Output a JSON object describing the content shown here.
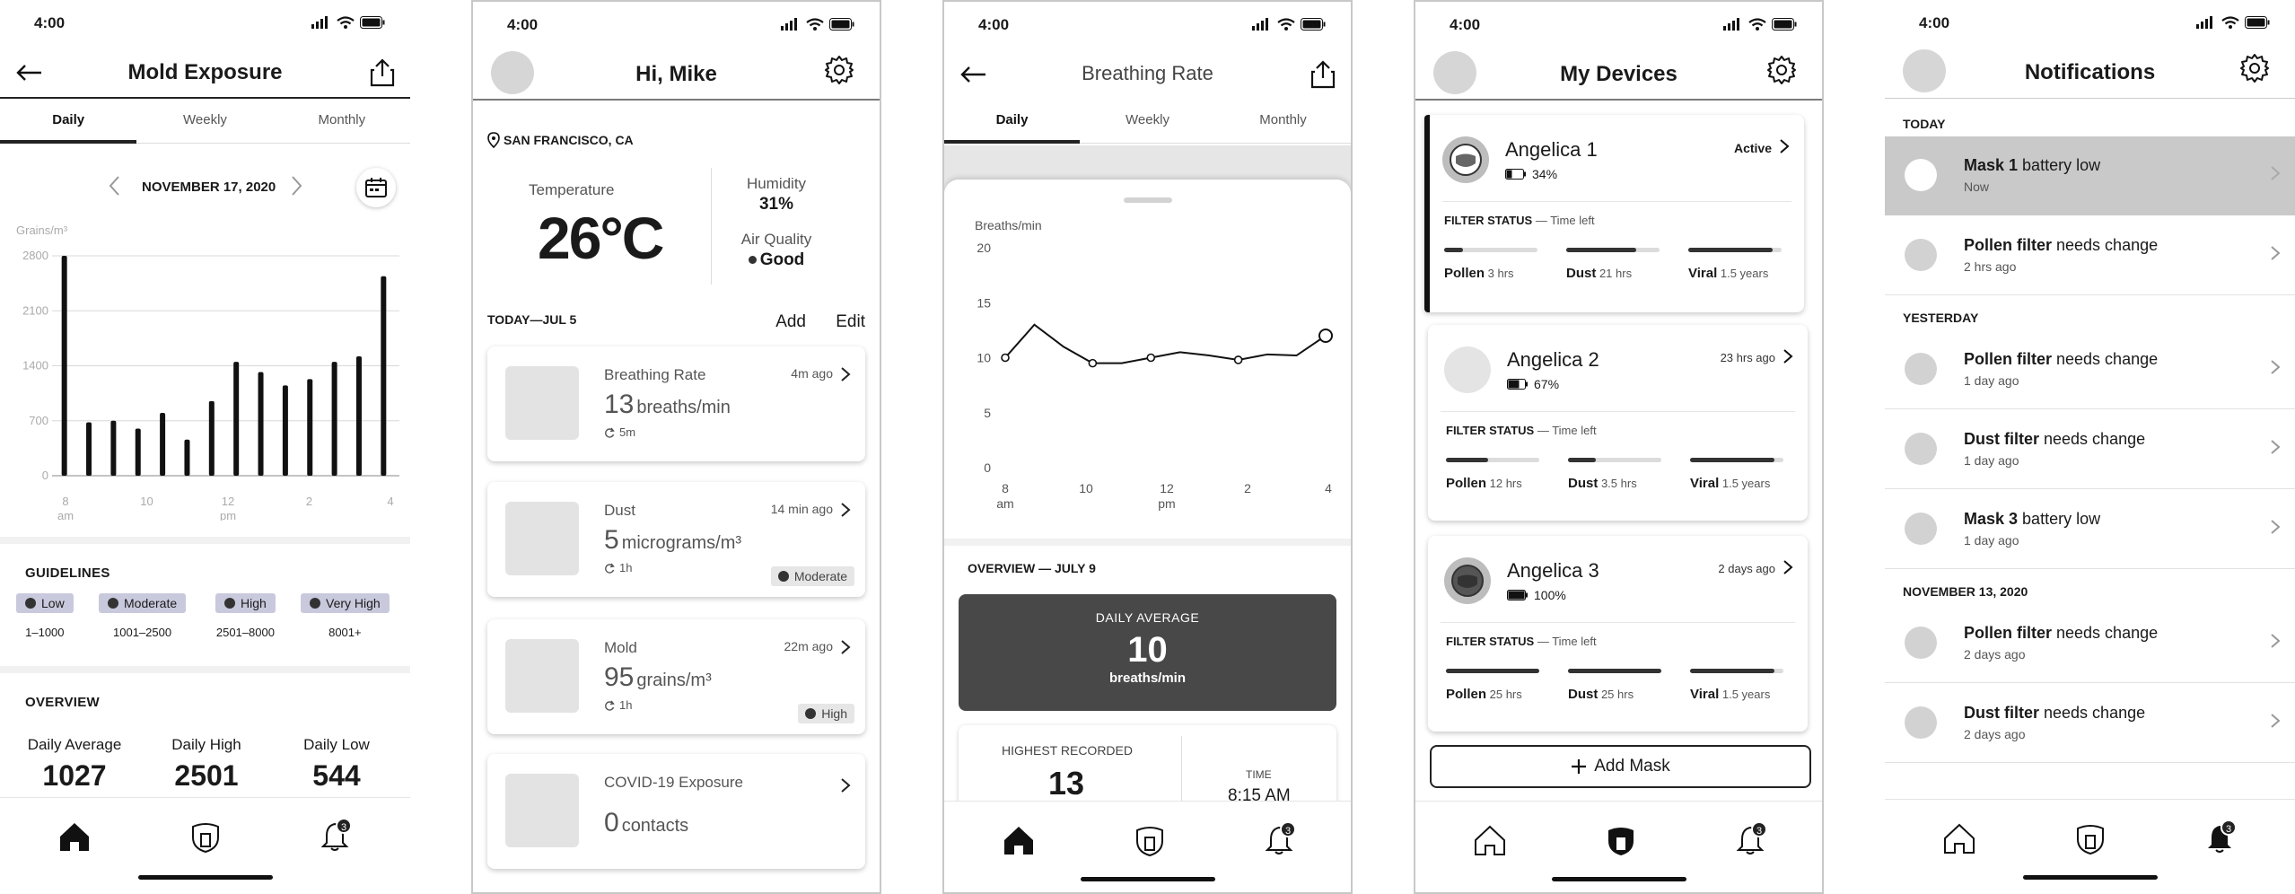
{
  "status_time": "4:00",
  "p1": {
    "title": "Mold Exposure",
    "tabs": [
      "Daily",
      "Weekly",
      "Monthly"
    ],
    "date": "NOVEMBER 17, 2020",
    "unit": "Grains/m³",
    "guidelines_title": "GUIDELINES",
    "guidelines": [
      {
        "label": "Low",
        "range": "1–1000"
      },
      {
        "label": "Moderate",
        "range": "1001–2500"
      },
      {
        "label": "High",
        "range": "2501–8000"
      },
      {
        "label": "Very High",
        "range": "8001+"
      }
    ],
    "overview_title": "OVERVIEW",
    "stats": [
      {
        "label": "Daily Average",
        "value": "1027"
      },
      {
        "label": "Daily High",
        "value": "2501"
      },
      {
        "label": "Daily Low",
        "value": "544"
      }
    ],
    "notif_badge": "3"
  },
  "chart_data": {
    "type": "bar",
    "ylabel": "Grains/m³",
    "ylim": [
      0,
      2800
    ],
    "yticks": [
      "0",
      "700",
      "1400",
      "2100",
      "2800"
    ],
    "xtick_labels": [
      {
        "top": "8",
        "bottom": "am"
      },
      {
        "top": "10",
        "bottom": ""
      },
      {
        "top": "12",
        "bottom": "pm"
      },
      {
        "top": "2",
        "bottom": ""
      },
      {
        "top": "4",
        "bottom": ""
      }
    ],
    "values": [
      2800,
      680,
      700,
      600,
      800,
      460,
      950,
      1450,
      1320,
      1150,
      1230,
      1450,
      1520,
      2540
    ]
  },
  "p2": {
    "greeting": "Hi, Mike",
    "location": "SAN FRANCISCO, CA",
    "temperature_label": "Temperature",
    "temperature": "26°C",
    "humidity_label": "Humidity",
    "humidity": "31%",
    "air_label": "Air Quality",
    "air_value": "Good",
    "today_label": "TODAY—JUL 5",
    "add": "Add",
    "edit": "Edit",
    "cards": [
      {
        "title": "Breathing Rate",
        "time": "4m ago",
        "value": "13",
        "unit": "breaths/min",
        "interval": "5m",
        "tag": ""
      },
      {
        "title": "Dust",
        "time": "14 min ago",
        "value": "5",
        "unit": "micrograms/m³",
        "interval": "1h",
        "tag": "Moderate"
      },
      {
        "title": "Mold",
        "time": "22m ago",
        "value": "95",
        "unit": "grains/m³",
        "interval": "1h",
        "tag": "High"
      },
      {
        "title": "COVID-19 Exposure",
        "time": "",
        "value": "0",
        "unit": "contacts",
        "interval": "",
        "tag": ""
      }
    ]
  },
  "p3": {
    "title": "Breathing Rate",
    "tabs": [
      "Daily",
      "Weekly",
      "Monthly"
    ],
    "chart_unit": "Breaths/min",
    "yticks": [
      "0",
      "5",
      "10",
      "15",
      "20"
    ],
    "xticks": [
      {
        "top": "8",
        "bottom": "am"
      },
      {
        "top": "10",
        "bottom": ""
      },
      {
        "top": "12",
        "bottom": "pm"
      },
      {
        "top": "2",
        "bottom": ""
      },
      {
        "top": "4",
        "bottom": ""
      }
    ],
    "series": [
      10,
      13,
      11,
      9.5,
      9.5,
      10,
      10.5,
      10.2,
      9.8,
      10.3,
      10.2,
      12
    ],
    "overview": "OVERVIEW — JULY 9",
    "avg_label": "DAILY AVERAGE",
    "avg_value": "10",
    "avg_unit": "breaths/min",
    "highest_label": "HIGHEST RECORDED",
    "highest_value": "13",
    "time_label": "TIME",
    "time_value": "8:15 AM"
  },
  "p4": {
    "title": "My Devices",
    "filter_label": "FILTER STATUS",
    "time_left": "— Time left",
    "devices": [
      {
        "name": "Angelica 1",
        "battery": "34%",
        "battery_level": 0.34,
        "status": "Active",
        "pollen": "3 hrs",
        "pollen_level": 0.2,
        "dust": "21 hrs",
        "dust_level": 0.75,
        "viral": "1.5 years",
        "viral_level": 0.9
      },
      {
        "name": "Angelica 2",
        "battery": "67%",
        "battery_level": 0.67,
        "status": "23 hrs ago",
        "pollen": "12 hrs",
        "pollen_level": 0.45,
        "dust": "3.5 hrs",
        "dust_level": 0.3,
        "viral": "1.5 years",
        "viral_level": 0.9
      },
      {
        "name": "Angelica 3",
        "battery": "100%",
        "battery_level": 1.0,
        "status": "2 days ago",
        "pollen": "25 hrs",
        "pollen_level": 1.0,
        "dust": "25 hrs",
        "dust_level": 1.0,
        "viral": "1.5 years",
        "viral_level": 0.9
      }
    ],
    "add_mask": "Add Mask"
  },
  "p5": {
    "title": "Notifications",
    "sections": [
      {
        "label": "TODAY",
        "items": [
          {
            "bold": "Mask 1",
            "rest": " battery low",
            "time": "Now",
            "highlight": true
          },
          {
            "bold": "Pollen filter",
            "rest": " needs change",
            "time": "2 hrs ago",
            "highlight": false
          }
        ]
      },
      {
        "label": "YESTERDAY",
        "items": [
          {
            "bold": "Pollen filter",
            "rest": " needs change",
            "time": "1 day ago",
            "highlight": false
          },
          {
            "bold": "Dust filter",
            "rest": " needs change",
            "time": "1 day ago",
            "highlight": false
          },
          {
            "bold": "Mask 3",
            "rest": " battery low",
            "time": "1 day ago",
            "highlight": false
          }
        ]
      },
      {
        "label": "NOVEMBER 13, 2020",
        "items": [
          {
            "bold": "Pollen filter",
            "rest": " needs change",
            "time": "2 days ago",
            "highlight": false
          },
          {
            "bold": "Dust filter",
            "rest": " needs change",
            "time": "2 days ago",
            "highlight": false
          }
        ]
      }
    ]
  }
}
